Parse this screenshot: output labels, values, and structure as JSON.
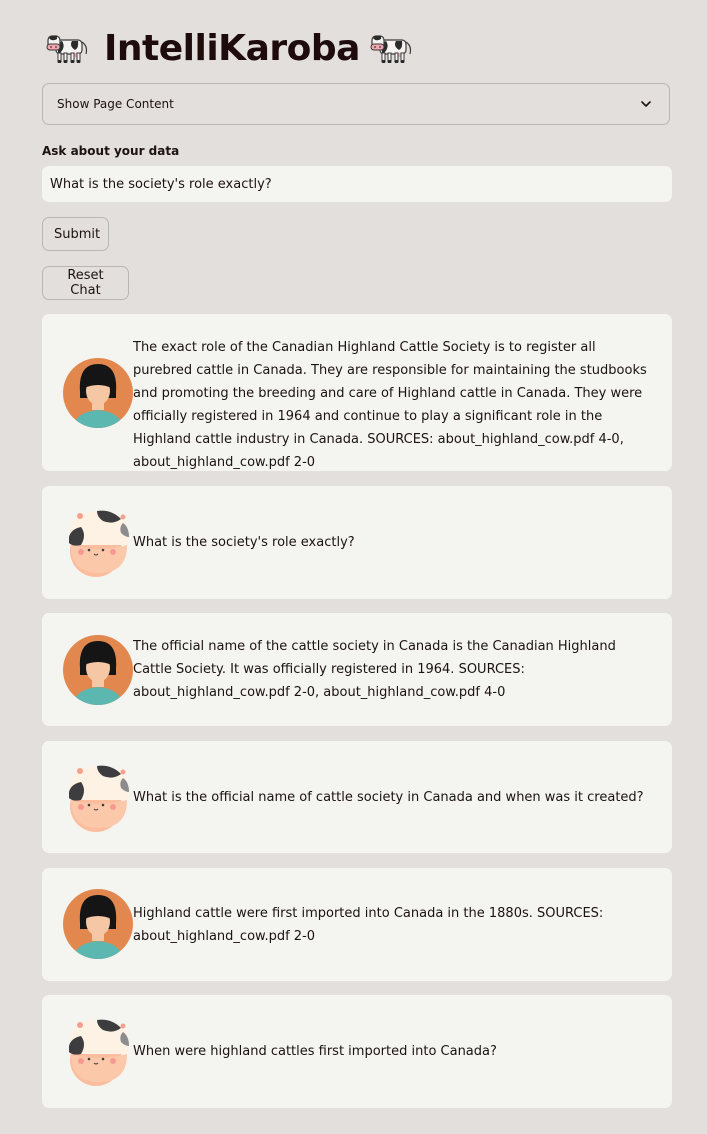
{
  "app": {
    "title": "IntelliKaroba"
  },
  "expander": {
    "label": "Show Page Content"
  },
  "query": {
    "label": "Ask about your data",
    "value": "What is the society's role exactly?"
  },
  "buttons": {
    "submit": "Submit",
    "reset": "Reset Chat"
  },
  "messages": [
    {
      "role": "assistant",
      "avatar": "person-avatar-icon",
      "text": "The exact role of the Canadian Highland Cattle Society is to register all purebred cattle in Canada. They are responsible for maintaining the studbooks and promoting the breeding and care of Highland cattle in Canada. They were officially registered in 1964 and continue to play a significant role in the Highland cattle industry in Canada. SOURCES: about_highland_cow.pdf 4-0, about_highland_cow.pdf 2-0"
    },
    {
      "role": "user",
      "avatar": "cow-avatar-icon",
      "text": "What is the society's role exactly?"
    },
    {
      "role": "assistant",
      "avatar": "person-avatar-icon",
      "text": "The official name of the cattle society in Canada is the Canadian Highland Cattle Society. It was officially registered in 1964. SOURCES: about_highland_cow.pdf 2-0, about_highland_cow.pdf 4-0"
    },
    {
      "role": "user",
      "avatar": "cow-avatar-icon",
      "text": "What is the official name of cattle society in Canada and when was it created?"
    },
    {
      "role": "assistant",
      "avatar": "person-avatar-icon",
      "text": "Highland cattle were first imported into Canada in the 1880s. SOURCES: about_highland_cow.pdf 2-0"
    },
    {
      "role": "user",
      "avatar": "cow-avatar-icon",
      "text": "When were highland cattles first imported into Canada?"
    }
  ],
  "colors": {
    "background": "#e3dfdc",
    "card": "#f4f5f1",
    "title": "#1e0b0c",
    "avatar_orange": "#e2884f",
    "avatar_teal": "#5cb7b0"
  }
}
